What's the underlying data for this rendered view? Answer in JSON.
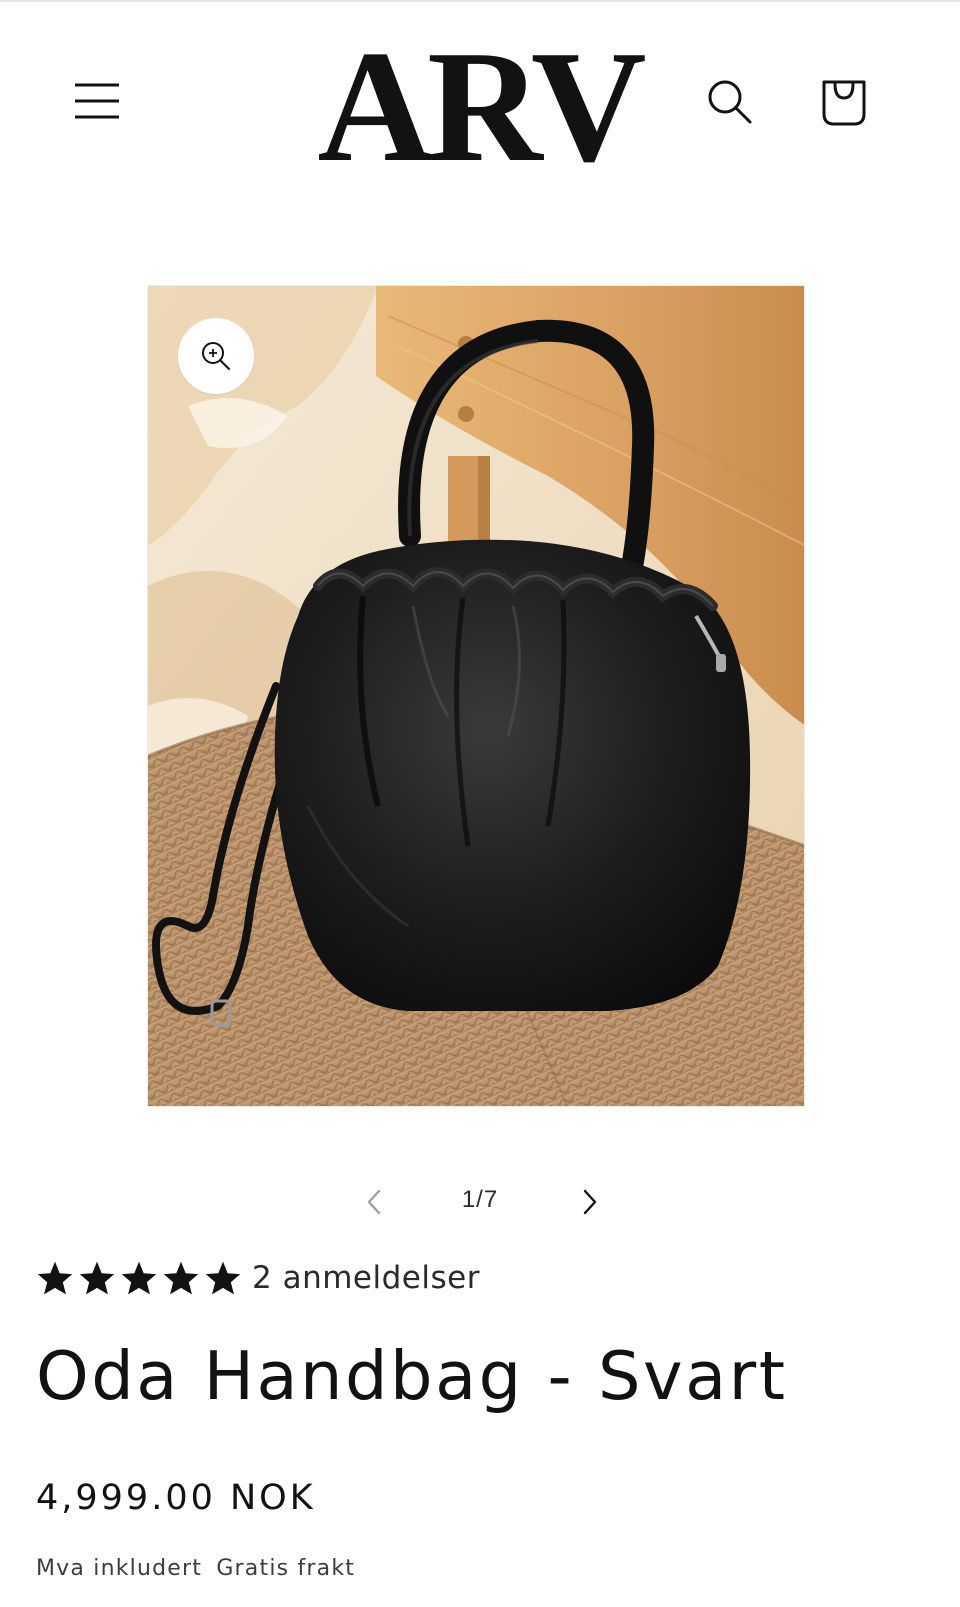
{
  "header": {
    "logo_text": "ARV",
    "menu_label": "Menu",
    "search_label": "Search",
    "cart_label": "Cart"
  },
  "product_media": {
    "image_alt": "Oda Handbag - Svart",
    "zoom_label": "Open media in modal"
  },
  "slider": {
    "counter": "1/7",
    "prev_label": "Previous slide",
    "next_label": "Next slide"
  },
  "rating": {
    "value": 5,
    "max": 5,
    "count_text": "2 anmeldelser"
  },
  "product": {
    "title": "Oda Handbag - Svart",
    "price": "4,999.00 NOK",
    "tax_note_1": "Mva inkludert",
    "tax_note_2": "Gratis frakt"
  },
  "colors": {
    "text": "#121212",
    "bag": "#151515",
    "wood": "#d9a66a",
    "rattan": "#b98f60",
    "background": "#ffffff"
  }
}
